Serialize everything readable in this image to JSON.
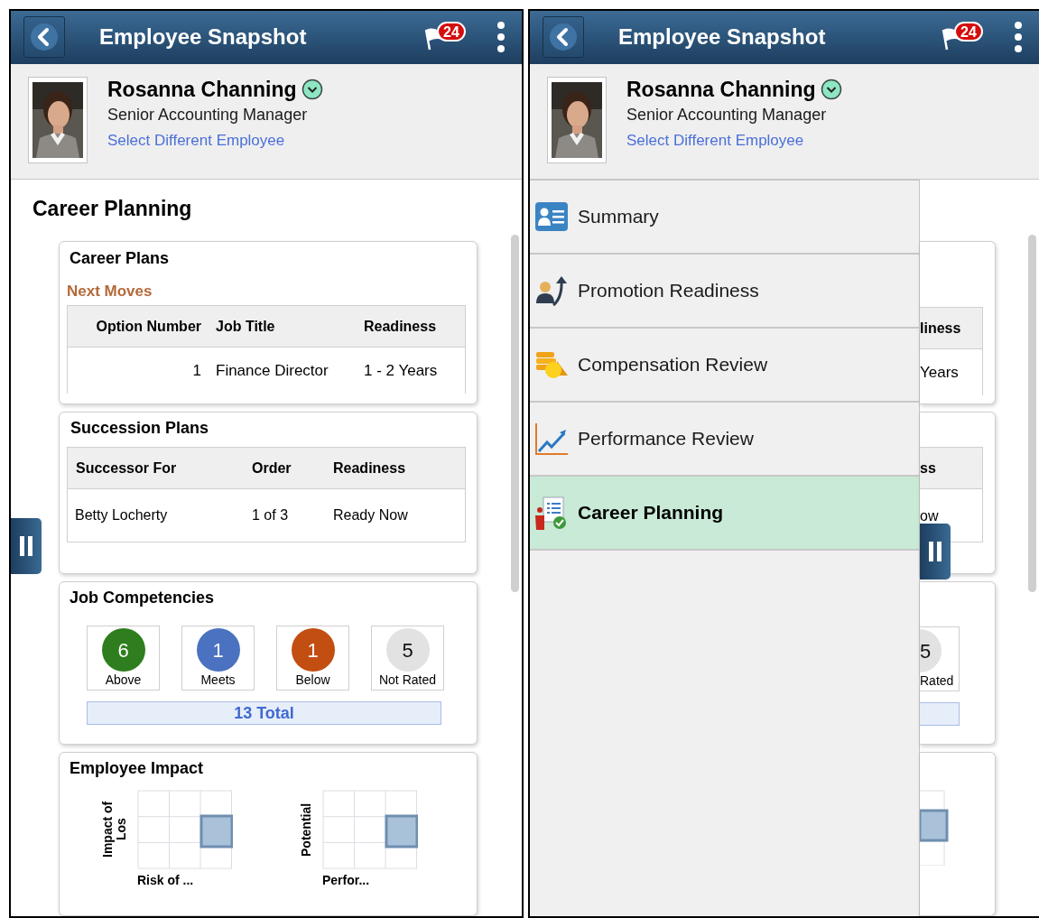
{
  "screens": [
    {
      "kind": "detail",
      "header": {
        "title": "Employee Snapshot",
        "flag_count": "24"
      },
      "profile": {
        "name": "Rosanna Channing",
        "job": "Senior Accounting Manager",
        "link": "Select Different Employee"
      },
      "page_title": "Career Planning",
      "career_plans": {
        "title": "Career Plans",
        "subtitle": "Next Moves",
        "columns": [
          "Option Number",
          "Job Title",
          "Readiness"
        ],
        "rows": [
          [
            "1",
            "Finance Director",
            "1 - 2 Years"
          ]
        ]
      },
      "succession_plans": {
        "title": "Succession Plans",
        "columns": [
          "Successor For",
          "Order",
          "Readiness"
        ],
        "rows": [
          [
            "Betty Locherty",
            "1 of 3",
            "Ready Now"
          ]
        ]
      },
      "job_competencies": {
        "title": "Job Competencies",
        "items": [
          {
            "count": "6",
            "label": "Above",
            "color": "#2e7d1e"
          },
          {
            "count": "1",
            "label": "Meets",
            "color": "#4a72c0"
          },
          {
            "count": "1",
            "label": "Below",
            "color": "#c24e12"
          },
          {
            "count": "5",
            "label": "Not Rated",
            "color": "#e2e2e2"
          }
        ],
        "total": "13 Total"
      },
      "employee_impact": {
        "title": "Employee Impact",
        "charts": [
          {
            "ylabel": "Impact of Los",
            "xlabel": "Risk of ..."
          },
          {
            "ylabel": "Potential",
            "xlabel": "Perfor..."
          }
        ]
      }
    },
    {
      "kind": "menu",
      "header": {
        "title": "Employee Snapshot",
        "flag_count": "24"
      },
      "profile": {
        "name": "Rosanna Channing",
        "job": "Senior Accounting Manager",
        "link": "Select Different Employee"
      },
      "menu": [
        {
          "label": "Summary",
          "selected": false
        },
        {
          "label": "Promotion Readiness",
          "selected": false
        },
        {
          "label": "Compensation Review",
          "selected": false
        },
        {
          "label": "Performance Review",
          "selected": false
        },
        {
          "label": "Career Planning",
          "selected": true
        }
      ],
      "behind": {
        "career_header": "liness",
        "career_cell": "Years",
        "succession_header": "ss",
        "succession_cell": "ow",
        "competency_count": "5",
        "competency_label": "Rated"
      }
    }
  ]
}
